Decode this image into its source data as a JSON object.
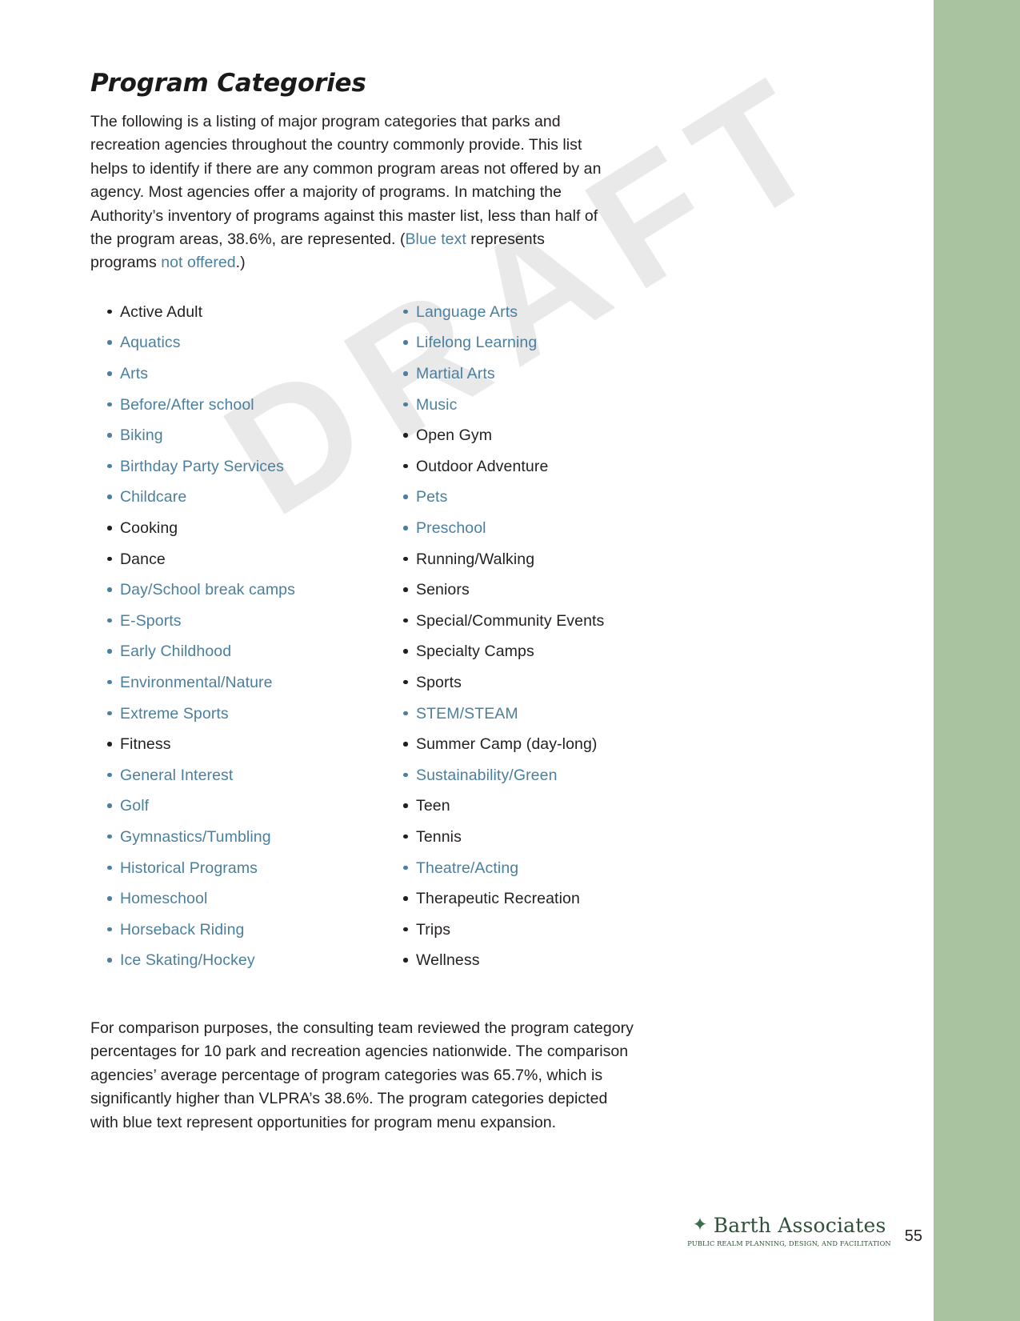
{
  "document": {
    "title": "Program Categories",
    "page_number": "55",
    "watermark": "DRAFT"
  },
  "intro": {
    "part1": "The following is a listing of major program categories that parks and recreation agencies throughout the country commonly provide. This list helps to identify if there are any common program areas not offered by an agency. Most agencies offer a majority of programs. In matching the Authority’s inventory of programs against this master list, less than half of the program areas, 38.6%, are represented. (",
    "blue_text_1": "Blue text",
    "part2": " represents programs ",
    "blue_text_2": "not offered",
    "part3": ".)"
  },
  "legend": {
    "offered_color": "#231f20",
    "not_offered_color": "#4b7f9e"
  },
  "columns": [
    {
      "items": [
        {
          "label": "Active Adult",
          "not_offered": false
        },
        {
          "label": "Aquatics",
          "not_offered": true
        },
        {
          "label": "Arts",
          "not_offered": true
        },
        {
          "label": "Before/After school",
          "not_offered": true
        },
        {
          "label": "Biking",
          "not_offered": true
        },
        {
          "label": "Birthday Party Services",
          "not_offered": true
        },
        {
          "label": "Childcare",
          "not_offered": true
        },
        {
          "label": "Cooking",
          "not_offered": false
        },
        {
          "label": "Dance",
          "not_offered": false
        },
        {
          "label": "Day/School break camps",
          "not_offered": true
        },
        {
          "label": "E-Sports",
          "not_offered": true
        },
        {
          "label": "Early Childhood",
          "not_offered": true
        },
        {
          "label": "Environmental/Nature",
          "not_offered": true
        },
        {
          "label": "Extreme Sports",
          "not_offered": true
        },
        {
          "label": "Fitness",
          "not_offered": false
        },
        {
          "label": "General Interest",
          "not_offered": true
        },
        {
          "label": "Golf",
          "not_offered": true
        },
        {
          "label": "Gymnastics/Tumbling",
          "not_offered": true
        },
        {
          "label": "Historical Programs",
          "not_offered": true
        },
        {
          "label": "Homeschool",
          "not_offered": true
        },
        {
          "label": "Horseback Riding",
          "not_offered": true
        },
        {
          "label": "Ice Skating/Hockey",
          "not_offered": true
        }
      ]
    },
    {
      "items": [
        {
          "label": "Language Arts",
          "not_offered": true
        },
        {
          "label": "Lifelong Learning",
          "not_offered": true
        },
        {
          "label": "Martial Arts",
          "not_offered": true
        },
        {
          "label": "Music",
          "not_offered": true
        },
        {
          "label": "Open Gym",
          "not_offered": false
        },
        {
          "label": "Outdoor Adventure",
          "not_offered": false
        },
        {
          "label": "Pets",
          "not_offered": true
        },
        {
          "label": "Preschool",
          "not_offered": true
        },
        {
          "label": "Running/Walking",
          "not_offered": false
        },
        {
          "label": "Seniors",
          "not_offered": false
        },
        {
          "label": "Special/Community Events",
          "not_offered": false
        },
        {
          "label": "Specialty Camps",
          "not_offered": false
        },
        {
          "label": "Sports",
          "not_offered": false
        },
        {
          "label": "STEM/STEAM",
          "not_offered": true
        },
        {
          "label": "Summer Camp (day-long)",
          "not_offered": false
        },
        {
          "label": "Sustainability/Green",
          "not_offered": true
        },
        {
          "label": "Teen",
          "not_offered": false
        },
        {
          "label": "Tennis",
          "not_offered": false
        },
        {
          "label": "Theatre/Acting",
          "not_offered": true
        },
        {
          "label": "Therapeutic Recreation",
          "not_offered": false
        },
        {
          "label": "Trips",
          "not_offered": false
        },
        {
          "label": "Wellness",
          "not_offered": false
        }
      ]
    }
  ],
  "closing": {
    "text": "For comparison purposes, the consulting team reviewed the program category percentages for 10 park and recreation agencies nationwide. The comparison agencies’ average percentage of program categories was 65.7%, which is significantly higher than VLPRA’s 38.6%. The program categories depicted with blue text represent opportunities for program menu expansion."
  },
  "footer": {
    "logo_mark": "diamond-icon",
    "logo_name": "Barth Associates",
    "logo_tagline": "PUBLIC REALM PLANNING, DESIGN, AND FACILITATION",
    "page_number": "55"
  }
}
